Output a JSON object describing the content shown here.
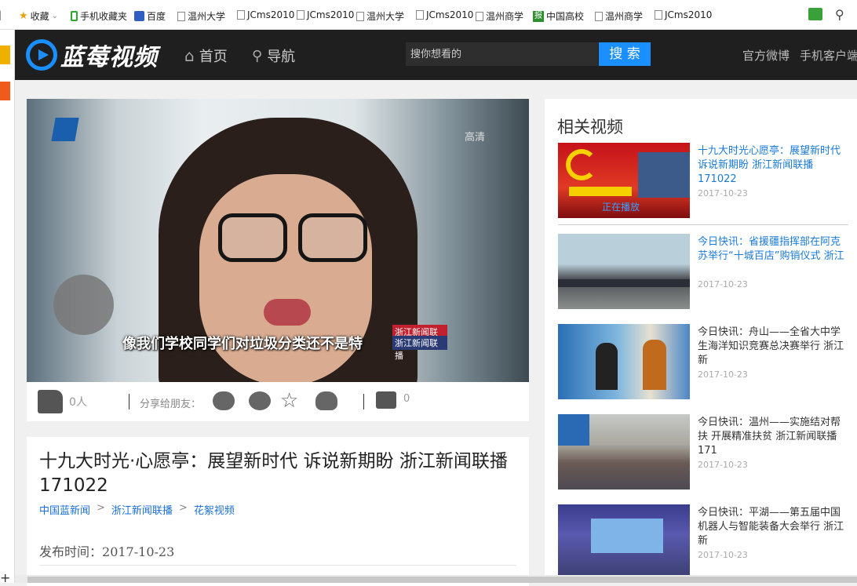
{
  "bookmarks": [
    {
      "label": "收藏",
      "icon": "star-icon"
    },
    {
      "label": "手机收藏夹",
      "icon": "phone-icon"
    },
    {
      "label": "百度",
      "icon": "paw-icon"
    },
    {
      "label": "温州大学",
      "icon": "page-icon"
    },
    {
      "label": "JCms2010",
      "icon": "page-icon"
    },
    {
      "label": "JCms2010",
      "icon": "page-icon"
    },
    {
      "label": "温州大学",
      "icon": "page-icon"
    },
    {
      "label": "JCms2010",
      "icon": "page-icon"
    },
    {
      "label": "温州商学",
      "icon": "page-icon"
    },
    {
      "label": "中国高校",
      "icon": "bao-icon"
    },
    {
      "label": "温州商学",
      "icon": "page-icon"
    },
    {
      "label": "JCms2010",
      "icon": "page-icon"
    }
  ],
  "header": {
    "logo_text": "蓝莓视频",
    "nav_home": "首页",
    "nav_guide": "导航",
    "search_placeholder": "搜你想看的",
    "search_button": "搜 索",
    "link_weibo": "官方微博",
    "link_client": "手机客户端"
  },
  "video": {
    "subtitle": "像我们学校同学们对垃圾分类还不是特",
    "badge_hd": "高清",
    "tag_line1": "浙江新闻联播",
    "tag_line2": "浙江新闻联播"
  },
  "actions": {
    "like_count": "0人",
    "share_label": "分享给朋友：",
    "comment_count": "0"
  },
  "article": {
    "title": "十九大时光·心愿亭：展望新时代 诉说新期盼 浙江新闻联播 171022",
    "breadcrumbs": [
      "中国蓝新闻",
      "浙江新闻联播",
      "花絮视频"
    ],
    "publish_label": "发布时间：",
    "publish_date": "2017-10-23"
  },
  "sidebar": {
    "title": "相关视频",
    "now_playing": "正在播放",
    "items": [
      {
        "title": "十九大时光心愿亭：展望新时代 诉说新期盼 浙江新闻联播 171022",
        "date": "2017-10-23",
        "active": true
      },
      {
        "title": "今日快讯：省援疆指挥部在阿克苏举行“十城百店”购销仪式 浙江",
        "date": "2017-10-23",
        "active": true
      },
      {
        "title": "今日快讯：舟山——全省大中学生海洋知识竞赛总决赛举行 浙江新",
        "date": "2017-10-23",
        "active": false
      },
      {
        "title": "今日快讯：温州——实施结对帮扶 开展精准扶贫 浙江新闻联播 171",
        "date": "2017-10-23",
        "active": false
      },
      {
        "title": "今日快讯：平湖——第五届中国机器人与智能装备大会举行 浙江新",
        "date": "2017-10-23",
        "active": false
      }
    ]
  },
  "colors": {
    "accent": "#1a8fff",
    "header_bg": "#1f1f1f",
    "link": "#1a7ad6"
  }
}
